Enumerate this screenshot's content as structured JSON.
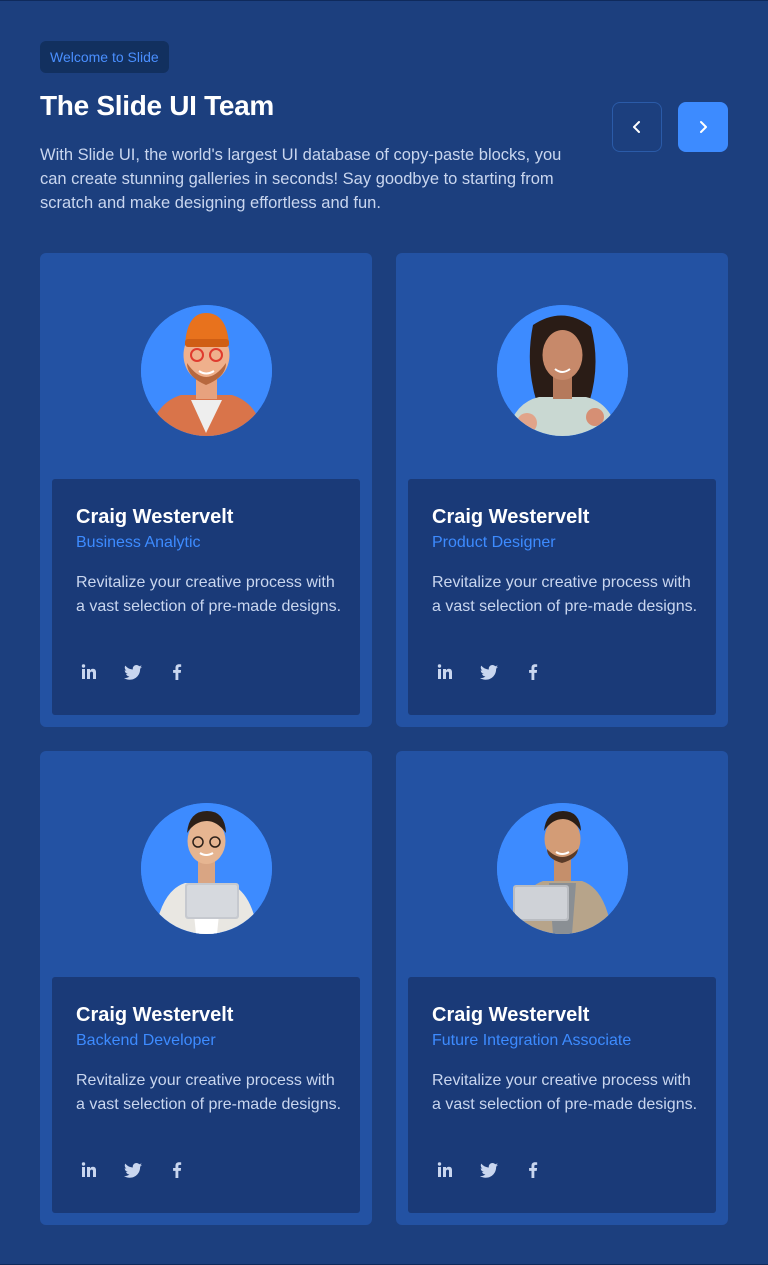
{
  "header": {
    "badge": "Welcome to Slide",
    "title": "The Slide UI Team",
    "description": "With Slide UI, the world's largest UI database of copy-paste blocks, you can create stunning galleries in seconds! Say goodbye to starting from scratch and make designing effortless and fun."
  },
  "nav": {
    "prev_icon": "chevron-left-icon",
    "next_icon": "chevron-right-icon"
  },
  "team": [
    {
      "name": "Craig Westervelt",
      "role": "Business Analytic",
      "bio": "Revitalize your creative process with a vast selection of pre-made designs.",
      "socials": [
        "linkedin-icon",
        "twitter-icon",
        "facebook-icon"
      ]
    },
    {
      "name": "Craig Westervelt",
      "role": "Product Designer",
      "bio": "Revitalize your creative process with a vast selection of pre-made designs.",
      "socials": [
        "linkedin-icon",
        "twitter-icon",
        "facebook-icon"
      ]
    },
    {
      "name": "Craig Westervelt",
      "role": "Backend Developer",
      "bio": "Revitalize your creative process with a vast selection of pre-made designs.",
      "socials": [
        "linkedin-icon",
        "twitter-icon",
        "facebook-icon"
      ]
    },
    {
      "name": "Craig Westervelt",
      "role": "Future Integration Associate",
      "bio": "Revitalize your creative process with a vast selection of pre-made designs.",
      "socials": [
        "linkedin-icon",
        "twitter-icon",
        "facebook-icon"
      ]
    }
  ],
  "colors": {
    "background": "#1c3f7e",
    "card": "#2352a3",
    "card_inner": "#1a3a78",
    "accent": "#3d8bff",
    "text": "#ffffff",
    "muted": "#c9d6ef"
  }
}
